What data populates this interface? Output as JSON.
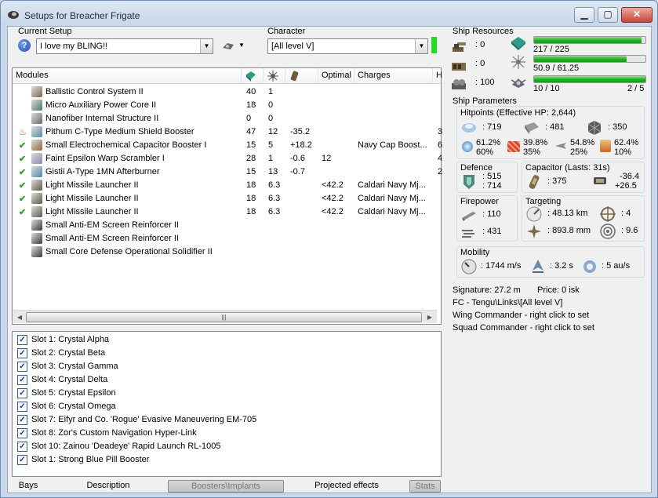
{
  "window": {
    "title": "Setups for Breacher Frigate",
    "controls": {
      "minimize": "▁",
      "maximize": "▢",
      "close": "✕"
    }
  },
  "setup": {
    "label": "Current Setup",
    "value": "I love my BLING!!",
    "help_icon": "?",
    "tool_icon": "drone-icon"
  },
  "character": {
    "label": "Character",
    "value": "[All level V]",
    "indicator_color": "#22dd22"
  },
  "modules": {
    "headers": [
      "Modules",
      "",
      "",
      "",
      "Optimal",
      "Charges",
      "H"
    ],
    "rows": [
      {
        "state": "",
        "name": "Ballistic Control System II",
        "c1": "40",
        "c2": "1",
        "c3": "",
        "optimal": "",
        "charges": "",
        "h": "",
        "icon_color": "#7a6a4a"
      },
      {
        "state": "",
        "name": "Micro Auxiliary Power Core II",
        "c1": "18",
        "c2": "0",
        "c3": "",
        "optimal": "",
        "charges": "",
        "h": "",
        "icon_color": "#4a7a6a"
      },
      {
        "state": "",
        "name": "Nanofiber Internal Structure II",
        "c1": "0",
        "c2": "0",
        "c3": "",
        "optimal": "",
        "charges": "",
        "h": "",
        "icon_color": "#6a6a6a"
      },
      {
        "state": "overheat",
        "name": "Pithum C-Type Medium Shield Booster",
        "c1": "47",
        "c2": "12",
        "c3": "-35.2",
        "optimal": "",
        "charges": "",
        "h": "3",
        "icon_color": "#5a8aa8"
      },
      {
        "state": "active",
        "name": "Small Electrochemical Capacitor Booster I",
        "c1": "15",
        "c2": "5",
        "c3": "+18.2",
        "optimal": "",
        "charges": "Navy Cap Boost...",
        "h": "6",
        "icon_color": "#8a6a3a"
      },
      {
        "state": "active",
        "name": "Faint Epsilon Warp Scrambler I",
        "c1": "28",
        "c2": "1",
        "c3": "-0.6",
        "optimal": "12",
        "charges": "",
        "h": "4",
        "icon_color": "#8a8aa8"
      },
      {
        "state": "active",
        "name": "Gistii A-Type 1MN Afterburner",
        "c1": "15",
        "c2": "13",
        "c3": "-0.7",
        "optimal": "",
        "charges": "",
        "h": "2",
        "icon_color": "#4a8aa8"
      },
      {
        "state": "active",
        "name": "Light Missile Launcher II",
        "c1": "18",
        "c2": "6.3",
        "c3": "",
        "optimal": "<42.2",
        "charges": "Caldari Navy Mj...",
        "h": "",
        "icon_color": "#5a5a4a"
      },
      {
        "state": "active",
        "name": "Light Missile Launcher II",
        "c1": "18",
        "c2": "6.3",
        "c3": "",
        "optimal": "<42.2",
        "charges": "Caldari Navy Mj...",
        "h": "",
        "icon_color": "#5a5a4a"
      },
      {
        "state": "active",
        "name": "Light Missile Launcher II",
        "c1": "18",
        "c2": "6.3",
        "c3": "",
        "optimal": "<42.2",
        "charges": "Caldari Navy Mj...",
        "h": "",
        "icon_color": "#5a5a4a"
      },
      {
        "state": "",
        "name": "Small Anti-EM Screen Reinforcer II",
        "c1": "",
        "c2": "",
        "c3": "",
        "optimal": "",
        "charges": "",
        "h": "",
        "icon_color": "#3a3a3a"
      },
      {
        "state": "",
        "name": "Small Anti-EM Screen Reinforcer II",
        "c1": "",
        "c2": "",
        "c3": "",
        "optimal": "",
        "charges": "",
        "h": "",
        "icon_color": "#3a3a3a"
      },
      {
        "state": "",
        "name": "Small Core Defense Operational Solidifier II",
        "c1": "",
        "c2": "",
        "c3": "",
        "optimal": "",
        "charges": "",
        "h": "",
        "icon_color": "#3a3a3a"
      }
    ]
  },
  "implants": [
    "Slot 1: Crystal Alpha",
    "Slot 2: Crystal Beta",
    "Slot 3: Crystal Gamma",
    "Slot 4: Crystal Delta",
    "Slot 5: Crystal Epsilon",
    "Slot 6: Crystal Omega",
    "Slot 7: Eifyr and Co. 'Rogue' Evasive Maneuvering EM-705",
    "Slot 8: Zor's Custom Navigation Hyper-Link",
    "Slot 10: Zainou 'Deadeye' Rapid Launch RL-1005",
    "Slot 1: Strong Blue Pill Booster"
  ],
  "tabs": [
    "Bays",
    "Description",
    "Boosters\\Implants",
    "Projected effects",
    "Stats"
  ],
  "resources": {
    "title": "Ship Resources",
    "turret": ": 0",
    "launcher": ": 0",
    "calibration": ": 100",
    "cpu": {
      "text": "217 / 225",
      "fill": 0.964
    },
    "power": {
      "text": "50.9 / 61.25",
      "fill": 0.831
    },
    "drone_bay": {
      "text": "10 / 10",
      "fill": 1.0
    },
    "drone_bw": "2 / 5"
  },
  "params": {
    "title": "Ship Parameters",
    "hitpoints": {
      "title": "Hitpoints (Effective HP: 2,644)",
      "shield": ": 719",
      "armor": ": 481",
      "hull": ": 350",
      "resists": [
        {
          "a": "61.2%",
          "b": "60%"
        },
        {
          "a": "39.8%",
          "b": "35%"
        },
        {
          "a": "54.8%",
          "b": "25%"
        },
        {
          "a": "62.4%",
          "b": "10%"
        }
      ]
    },
    "defence": {
      "title": "Defence",
      "v1": ": 515",
      "v2": ": 714"
    },
    "capacitor": {
      "title": "Capacitor (Lasts: 31s)",
      "amount": ": 375",
      "v1": "-36.4",
      "v2": "+26.5"
    },
    "firepower": {
      "title": "Firepower",
      "v1": ": 110",
      "v2": ": 431"
    },
    "targeting": {
      "title": "Targeting",
      "range": ": 48.13 km",
      "targets": ": 4",
      "resolution": ": 893.8 mm",
      "sensor": ": 9.6"
    },
    "mobility": {
      "title": "Mobility",
      "speed": ": 1744 m/s",
      "align": ": 3.2 s",
      "warp": ": 5 au/s"
    },
    "signature": "Signature: 27.2 m",
    "price": "Price: 0 isk",
    "fleet": "FC - Tengu\\Links\\[All level V]",
    "wing": "Wing Commander - right click to set",
    "squad": "Squad Commander - right click to set"
  }
}
